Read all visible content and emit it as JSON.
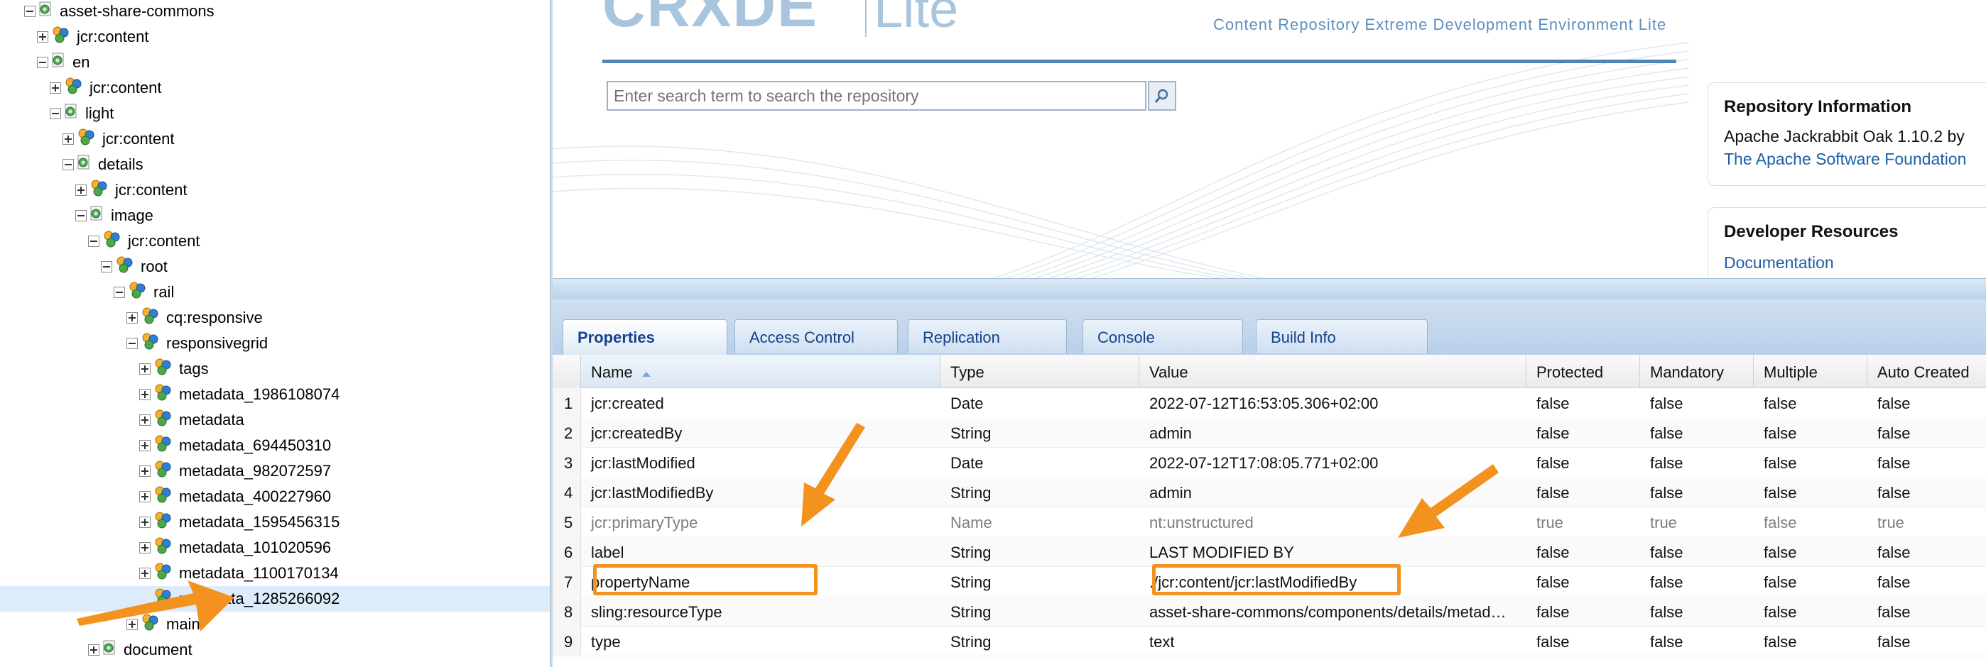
{
  "tree": {
    "nodes": [
      {
        "label": "asset-share-commons",
        "depth": 0,
        "toggle": "minus",
        "icon": "folder-page-icon"
      },
      {
        "label": "jcr:content",
        "depth": 1,
        "toggle": "plus",
        "icon": "node-icon"
      },
      {
        "label": "en",
        "depth": 1,
        "toggle": "minus",
        "icon": "folder-page-icon"
      },
      {
        "label": "jcr:content",
        "depth": 2,
        "toggle": "plus",
        "icon": "node-icon"
      },
      {
        "label": "light",
        "depth": 2,
        "toggle": "minus",
        "icon": "folder-page-icon"
      },
      {
        "label": "jcr:content",
        "depth": 3,
        "toggle": "plus",
        "icon": "node-icon"
      },
      {
        "label": "details",
        "depth": 3,
        "toggle": "minus",
        "icon": "folder-page-icon"
      },
      {
        "label": "jcr:content",
        "depth": 4,
        "toggle": "plus",
        "icon": "node-icon"
      },
      {
        "label": "image",
        "depth": 4,
        "toggle": "minus",
        "icon": "folder-page-icon"
      },
      {
        "label": "jcr:content",
        "depth": 5,
        "toggle": "minus",
        "icon": "node-icon"
      },
      {
        "label": "root",
        "depth": 6,
        "toggle": "minus",
        "icon": "node-icon"
      },
      {
        "label": "rail",
        "depth": 7,
        "toggle": "minus",
        "icon": "node-icon"
      },
      {
        "label": "cq:responsive",
        "depth": 8,
        "toggle": "plus",
        "icon": "node-icon"
      },
      {
        "label": "responsivegrid",
        "depth": 8,
        "toggle": "minus",
        "icon": "node-icon"
      },
      {
        "label": "tags",
        "depth": 9,
        "toggle": "plus",
        "icon": "node-icon"
      },
      {
        "label": "metadata_1986108074",
        "depth": 9,
        "toggle": "plus",
        "icon": "node-icon"
      },
      {
        "label": "metadata",
        "depth": 9,
        "toggle": "plus",
        "icon": "node-icon"
      },
      {
        "label": "metadata_694450310",
        "depth": 9,
        "toggle": "plus",
        "icon": "node-icon"
      },
      {
        "label": "metadata_982072597",
        "depth": 9,
        "toggle": "plus",
        "icon": "node-icon"
      },
      {
        "label": "metadata_400227960",
        "depth": 9,
        "toggle": "plus",
        "icon": "node-icon"
      },
      {
        "label": "metadata_1595456315",
        "depth": 9,
        "toggle": "plus",
        "icon": "node-icon"
      },
      {
        "label": "metadata_101020596",
        "depth": 9,
        "toggle": "plus",
        "icon": "node-icon"
      },
      {
        "label": "metadata_1100170134",
        "depth": 9,
        "toggle": "plus",
        "icon": "node-icon"
      },
      {
        "label": "metadata_1285266092",
        "depth": 9,
        "toggle": "none",
        "icon": "node-icon",
        "selected": true
      },
      {
        "label": "main",
        "depth": 8,
        "toggle": "plus",
        "icon": "node-icon"
      },
      {
        "label": "document",
        "depth": 5,
        "toggle": "plus",
        "icon": "folder-page-icon"
      }
    ]
  },
  "header": {
    "logo_main": "CRXDE",
    "logo_lite": "Lite",
    "subtitle": "Content Repository Extreme Development Environment Lite",
    "search": {
      "placeholder": "Enter search term to search the repository",
      "icon": "search-icon"
    }
  },
  "repository_info": {
    "title": "Repository Information",
    "line1": "Apache Jackrabbit Oak 1.10.2 by",
    "line2": "The Apache Software Foundation"
  },
  "developer_resources": {
    "title": "Developer Resources",
    "link": "Documentation"
  },
  "tabs": [
    "Properties",
    "Access Control",
    "Replication",
    "Console",
    "Build Info"
  ],
  "active_tab": "Properties",
  "grid": {
    "columns": [
      "Name",
      "Type",
      "Value",
      "Protected",
      "Mandatory",
      "Multiple",
      "Auto Created"
    ],
    "sorted_column": "Name",
    "rows": [
      {
        "n": "1",
        "name": "jcr:created",
        "type": "Date",
        "value": "2022-07-12T16:53:05.306+02:00",
        "protected": "false",
        "mandatory": "false",
        "multiple": "false",
        "auto": "false"
      },
      {
        "n": "2",
        "name": "jcr:createdBy",
        "type": "String",
        "value": "admin",
        "protected": "false",
        "mandatory": "false",
        "multiple": "false",
        "auto": "false"
      },
      {
        "n": "3",
        "name": "jcr:lastModified",
        "type": "Date",
        "value": "2022-07-12T17:08:05.771+02:00",
        "protected": "false",
        "mandatory": "false",
        "multiple": "false",
        "auto": "false"
      },
      {
        "n": "4",
        "name": "jcr:lastModifiedBy",
        "type": "String",
        "value": "admin",
        "protected": "false",
        "mandatory": "false",
        "multiple": "false",
        "auto": "false"
      },
      {
        "n": "5",
        "name": "jcr:primaryType",
        "type": "Name",
        "value": "nt:unstructured",
        "protected": "true",
        "mandatory": "true",
        "multiple": "false",
        "auto": "true",
        "dim": true
      },
      {
        "n": "6",
        "name": "label",
        "type": "String",
        "value": "LAST MODIFIED BY",
        "protected": "false",
        "mandatory": "false",
        "multiple": "false",
        "auto": "false"
      },
      {
        "n": "7",
        "name": "propertyName",
        "type": "String",
        "value": "./jcr:content/jcr:lastModifiedBy",
        "protected": "false",
        "mandatory": "false",
        "multiple": "false",
        "auto": "false"
      },
      {
        "n": "8",
        "name": "sling:resourceType",
        "type": "String",
        "value": "asset-share-commons/components/details/metad…",
        "protected": "false",
        "mandatory": "false",
        "multiple": "false",
        "auto": "false"
      },
      {
        "n": "9",
        "name": "type",
        "type": "String",
        "value": "text",
        "protected": "false",
        "mandatory": "false",
        "multiple": "false",
        "auto": "false"
      }
    ]
  },
  "colors": {
    "annotation": "#f3921f",
    "selection": "#dcecfb",
    "link": "#1f5fa8",
    "header_rule": "#4f85b6"
  }
}
